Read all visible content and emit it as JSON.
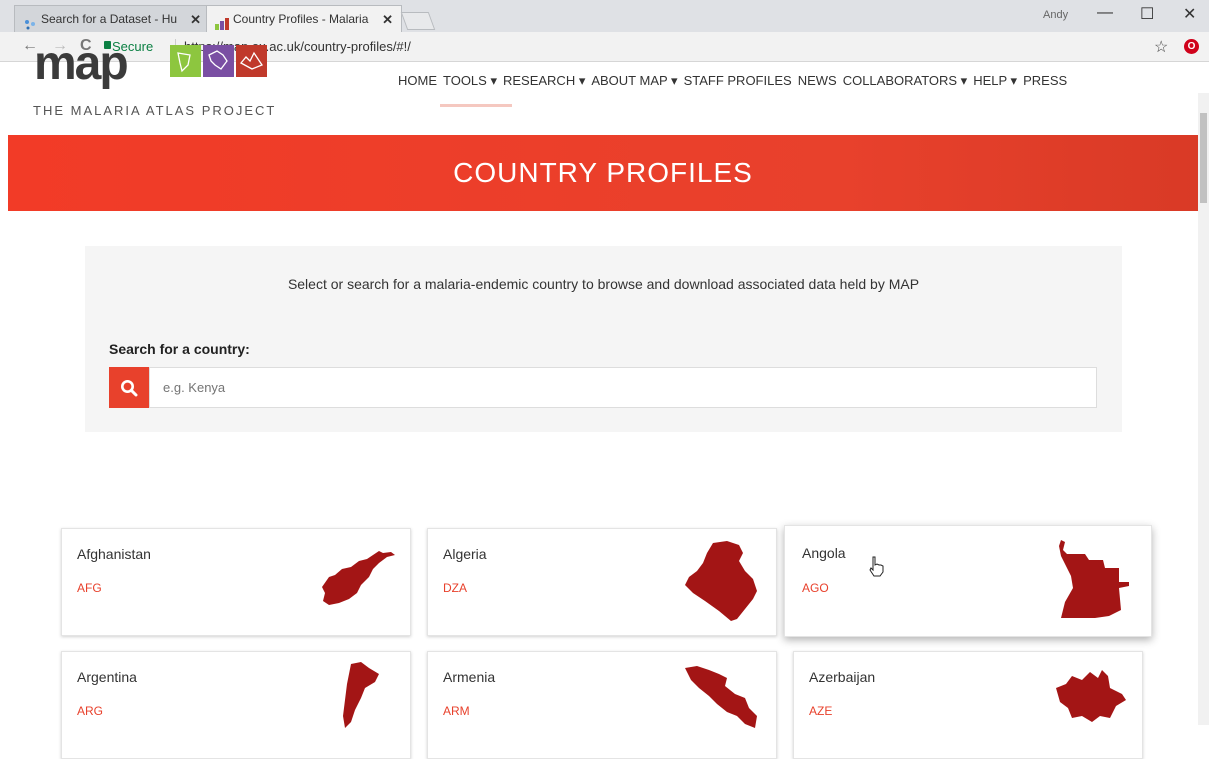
{
  "browser": {
    "tabs": [
      {
        "title": "Search for a Dataset - Hu",
        "close": "✕",
        "active": false
      },
      {
        "title": "Country Profiles - Malaria",
        "close": "✕",
        "active": true
      }
    ],
    "user": "Andy",
    "window_controls": {
      "minimize": "—",
      "maximize": "☐",
      "close": "✕"
    },
    "nav": {
      "back": "←",
      "forward": "→",
      "reload": "C"
    },
    "secure_label": "Secure",
    "url": "https://map.ox.ac.uk/country-profiles/#!/",
    "star": "☆",
    "extension": "O"
  },
  "site": {
    "logo_word": "map",
    "logo_subtitle": "THE MALARIA ATLAS PROJECT",
    "logo_colors": [
      "#8dc63f",
      "#7a4fa3",
      "#c0392b"
    ],
    "menu": [
      "HOME",
      "TOOLS ▾",
      "RESEARCH ▾",
      "ABOUT MAP ▾",
      "STAFF PROFILES",
      "NEWS",
      "COLLABORATORS ▾",
      "HELP ▾",
      "PRESS"
    ]
  },
  "banner": {
    "title": "COUNTRY PROFILES",
    "color": "#e8412c"
  },
  "search": {
    "intro": "Select or search for a malaria-endemic country to browse and download associated data held by MAP",
    "label": "Search for a country:",
    "placeholder": "e.g. Kenya",
    "icon": "search-icon"
  },
  "countries": [
    {
      "name": "Afghanistan",
      "code": "AFG"
    },
    {
      "name": "Algeria",
      "code": "DZA"
    },
    {
      "name": "Angola",
      "code": "AGO"
    },
    {
      "name": "Argentina",
      "code": "ARG"
    },
    {
      "name": "Armenia",
      "code": "ARM"
    },
    {
      "name": "Azerbaijan",
      "code": "AZE"
    }
  ],
  "shape_color": "#a31515"
}
